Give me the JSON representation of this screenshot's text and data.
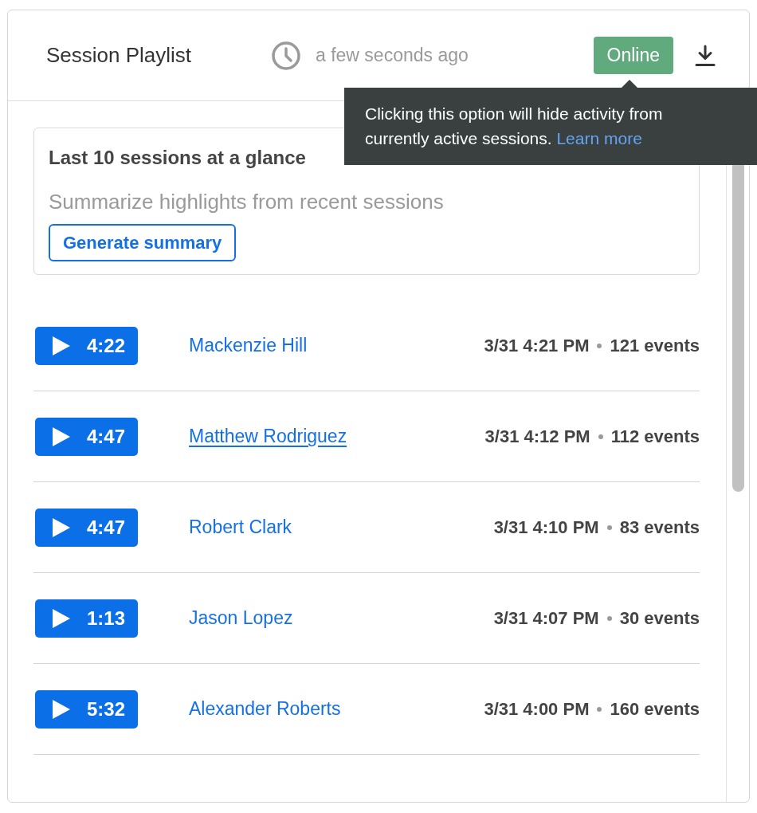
{
  "header": {
    "title": "Session Playlist",
    "updated": "a few seconds ago",
    "status_toggle": {
      "label": "Online",
      "on": true
    }
  },
  "tooltip": {
    "text": "Clicking this option will hide activity from currently active sessions.",
    "link": "Learn more"
  },
  "summary_card": {
    "title": "Last 10 sessions at a glance",
    "subtitle": "Summarize highlights from recent sessions",
    "button": "Generate summary"
  },
  "sessions": [
    {
      "duration": "4:22",
      "user": "Mackenzie Hill",
      "time": "3/31 4:21 PM",
      "events": "121 events",
      "hovered": false
    },
    {
      "duration": "4:47",
      "user": "Matthew Rodriguez",
      "time": "3/31 4:12 PM",
      "events": "112 events",
      "hovered": true
    },
    {
      "duration": "4:47",
      "user": "Robert Clark",
      "time": "3/31 4:10 PM",
      "events": "83 events",
      "hovered": false
    },
    {
      "duration": "1:13",
      "user": "Jason Lopez",
      "time": "3/31 4:07 PM",
      "events": "30 events",
      "hovered": false
    },
    {
      "duration": "5:32",
      "user": "Alexander Roberts",
      "time": "3/31 4:00 PM",
      "events": "160 events",
      "hovered": false
    }
  ]
}
